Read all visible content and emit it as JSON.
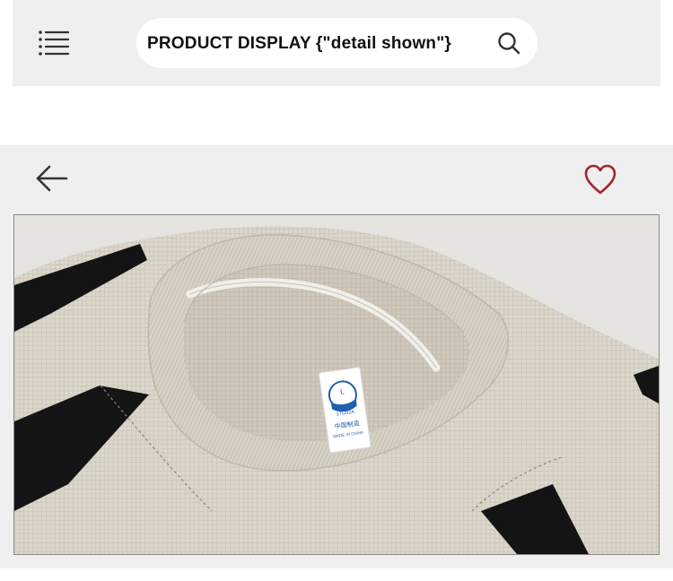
{
  "header": {
    "search_text": "PRODUCT DISPLAY {\"detail shown\"}",
    "menu_icon": "menu-icon",
    "search_icon": "search-icon"
  },
  "detail": {
    "back_icon": "arrow-left-icon",
    "favorite_icon": "heart-icon",
    "favorite_color": "#a4252b",
    "photo_subject": "beige waffle-knit t-shirt with black panels, close-up of collar and neck label"
  },
  "label": {
    "size": "L",
    "fit": "175/92A",
    "origin_cn": "中国制造",
    "origin_en": "MADE IN CHINA"
  },
  "colors": {
    "header_bg": "#efefef",
    "panel_bg": "#efefef",
    "shirt": "#dcd6cb",
    "panel_black": "#141414",
    "label_blue": "#1f5fb0"
  }
}
